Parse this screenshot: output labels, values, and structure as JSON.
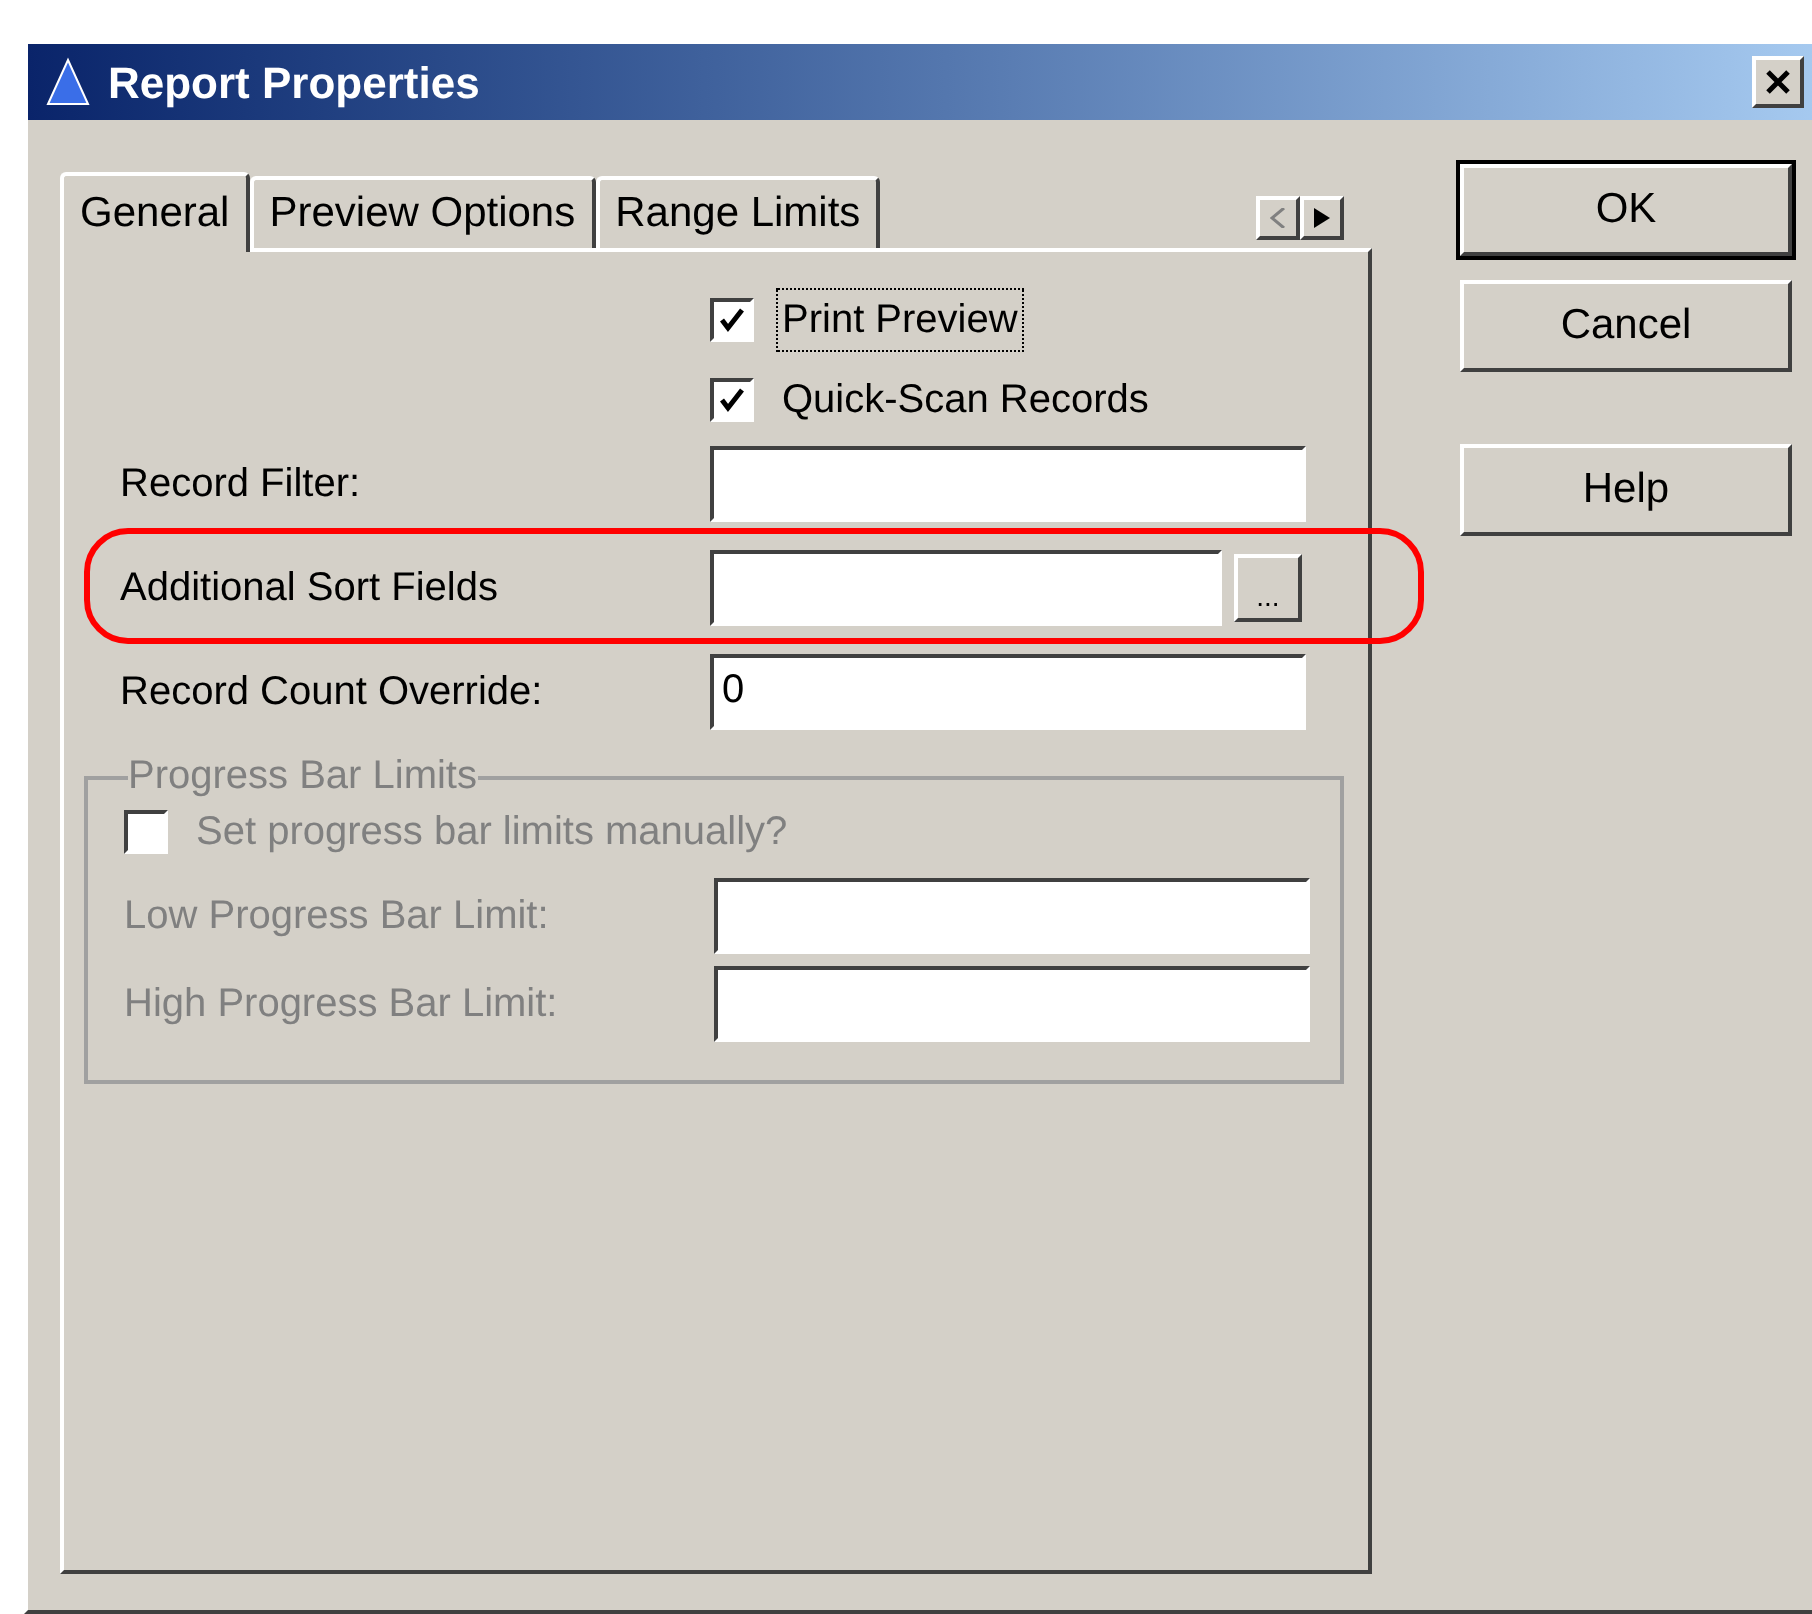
{
  "window": {
    "title": "Report Properties"
  },
  "tabs": [
    {
      "label": "General",
      "selected": true
    },
    {
      "label": "Preview Options",
      "selected": false
    },
    {
      "label": "Range Limits",
      "selected": false
    }
  ],
  "fields": [
    {
      "kind": "checkbox",
      "label": "Print Preview",
      "checked": true,
      "focused": true
    },
    {
      "kind": "checkbox",
      "label": "Quick-Scan Records",
      "checked": true,
      "focused": false
    },
    {
      "kind": "text",
      "label": "Record Filter:"
    },
    {
      "kind": "browse",
      "label": "Additional Sort Fields",
      "browse": "..."
    },
    {
      "kind": "text",
      "label": "Record Count Override:",
      "value": "0"
    }
  ],
  "group": {
    "title": "Progress Bar Limits",
    "disabled": true,
    "fields": [
      {
        "kind": "checkbox",
        "label": "Set progress bar limits manually?",
        "checked": false
      },
      {
        "kind": "text",
        "label": "Low Progress Bar Limit:"
      },
      {
        "kind": "text",
        "label": "High Progress Bar Limit:"
      }
    ]
  },
  "buttons": [
    {
      "label": "OK",
      "default": true
    },
    {
      "label": "Cancel",
      "default": false
    },
    {
      "label": "Help",
      "default": false
    }
  ]
}
